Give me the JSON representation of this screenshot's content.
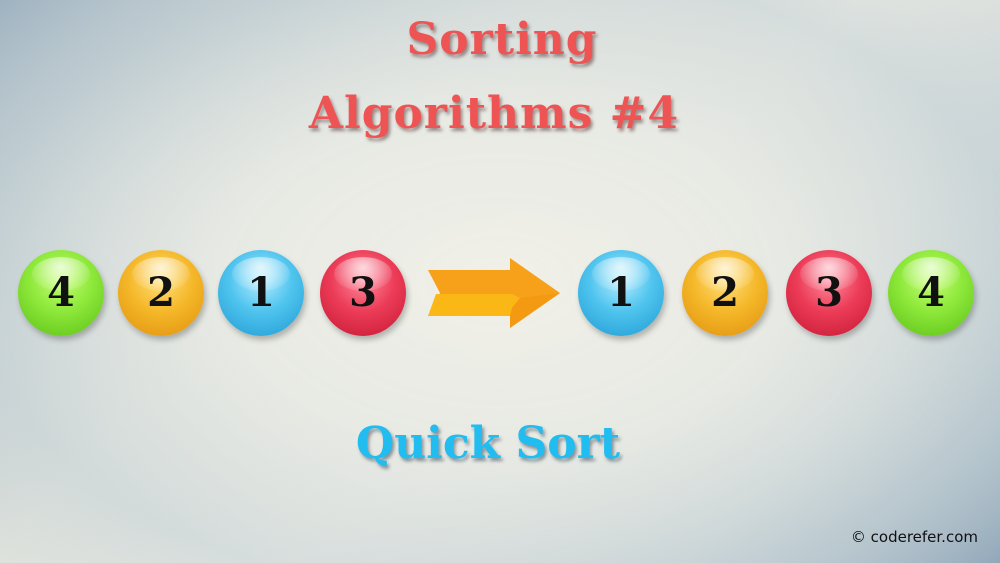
{
  "title": {
    "line1": "Sorting",
    "line2": "Algorithms #4"
  },
  "unsorted_balls": [
    {
      "value": "4",
      "color": "green"
    },
    {
      "value": "2",
      "color": "orange"
    },
    {
      "value": "1",
      "color": "blue"
    },
    {
      "value": "3",
      "color": "red"
    }
  ],
  "arrow_icon": "right-arrow-icon",
  "sorted_balls": [
    {
      "value": "1",
      "color": "blue"
    },
    {
      "value": "2",
      "color": "orange"
    },
    {
      "value": "3",
      "color": "red"
    },
    {
      "value": "4",
      "color": "green"
    }
  ],
  "subtitle": "Quick Sort",
  "copyright": "© coderefer.com",
  "colors": {
    "title": "#ef5454",
    "subtitle": "#22bdf0",
    "arrow": "#f7a11a",
    "green": "#8de83a",
    "orange": "#f5b82a",
    "blue": "#4fc4ee",
    "red": "#ec3c58"
  }
}
